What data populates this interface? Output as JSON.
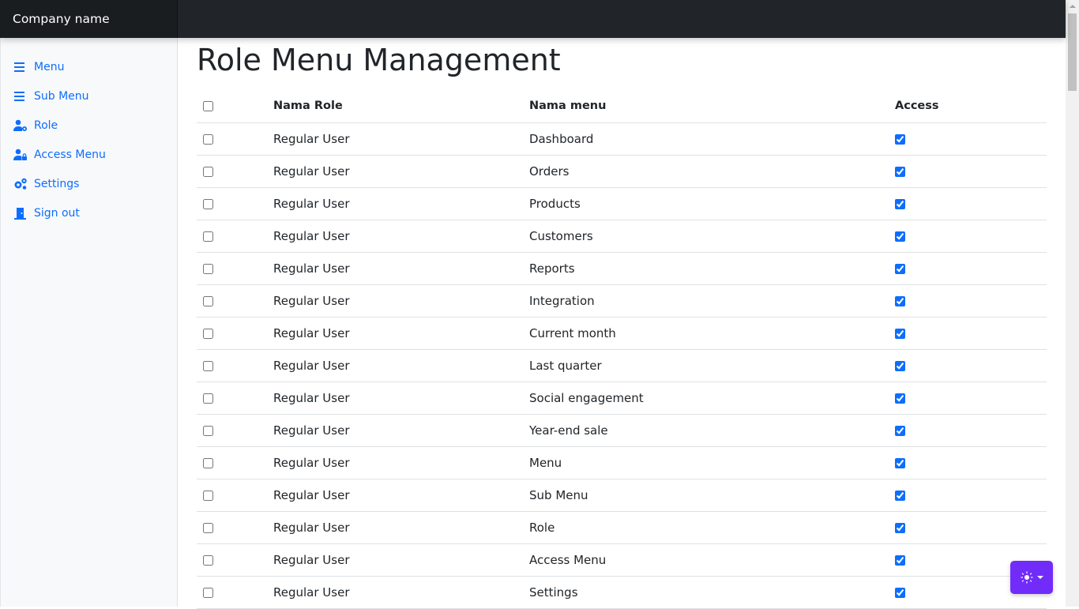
{
  "brand": "Company name",
  "sidebar": {
    "items": [
      {
        "label": "Menu",
        "icon": "bars-icon"
      },
      {
        "label": "Sub Menu",
        "icon": "bars-icon"
      },
      {
        "label": "Role",
        "icon": "user-gear-icon"
      },
      {
        "label": "Access Menu",
        "icon": "user-lock-icon"
      },
      {
        "label": "Settings",
        "icon": "gears-icon"
      },
      {
        "label": "Sign out",
        "icon": "door-exit-icon"
      }
    ]
  },
  "page": {
    "title": "Role Menu Management"
  },
  "table": {
    "headers": [
      "",
      "Nama Role",
      "Nama menu",
      "Access"
    ],
    "rows": [
      {
        "role": "Regular User",
        "menu": "Dashboard",
        "access": true
      },
      {
        "role": "Regular User",
        "menu": "Orders",
        "access": true
      },
      {
        "role": "Regular User",
        "menu": "Products",
        "access": true
      },
      {
        "role": "Regular User",
        "menu": "Customers",
        "access": true
      },
      {
        "role": "Regular User",
        "menu": "Reports",
        "access": true
      },
      {
        "role": "Regular User",
        "menu": "Integration",
        "access": true
      },
      {
        "role": "Regular User",
        "menu": "Current month",
        "access": true
      },
      {
        "role": "Regular User",
        "menu": "Last quarter",
        "access": true
      },
      {
        "role": "Regular User",
        "menu": "Social engagement",
        "access": true
      },
      {
        "role": "Regular User",
        "menu": "Year-end sale",
        "access": true
      },
      {
        "role": "Regular User",
        "menu": "Menu",
        "access": true
      },
      {
        "role": "Regular User",
        "menu": "Sub Menu",
        "access": true
      },
      {
        "role": "Regular User",
        "menu": "Role",
        "access": true
      },
      {
        "role": "Regular User",
        "menu": "Access Menu",
        "access": true
      },
      {
        "role": "Regular User",
        "menu": "Settings",
        "access": true
      }
    ]
  },
  "theme_toggle": {
    "icon": "sun-icon"
  },
  "colors": {
    "navbar": "#212529",
    "link": "#0d6efd",
    "theme_button": "#712cf9"
  }
}
